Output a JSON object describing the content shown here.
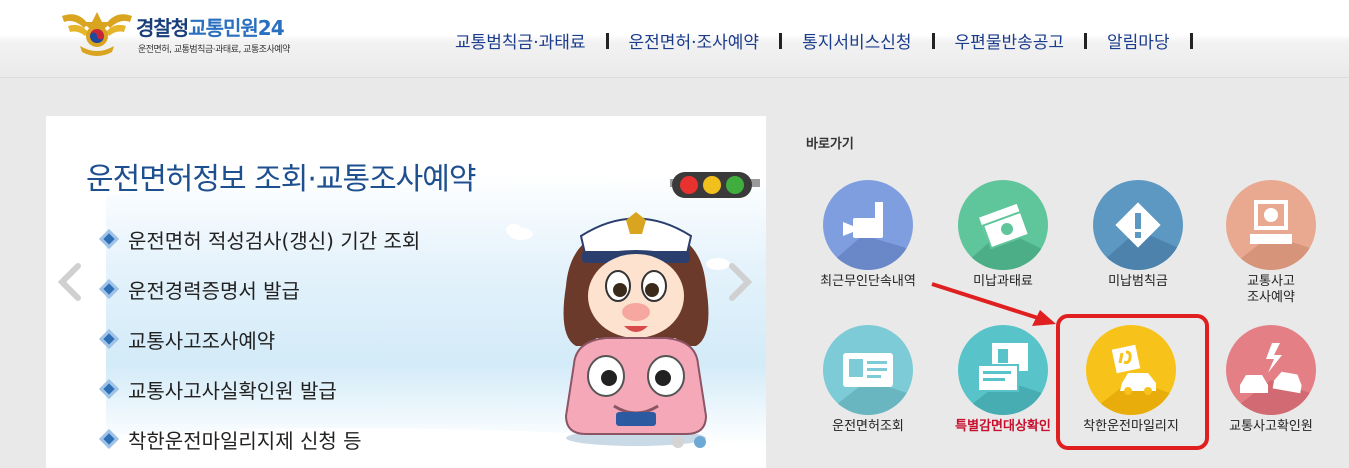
{
  "header": {
    "logo": {
      "title_part1": "경찰청",
      "title_part2": "교통민원24",
      "subtitle": "운전면허, 교통범칙금·과태료, 교통조사예약"
    },
    "nav": [
      {
        "label": "교통범칙금·과태료"
      },
      {
        "label": "운전면허·조사예약"
      },
      {
        "label": "통지서비스신청"
      },
      {
        "label": "우편물반송공고"
      },
      {
        "label": "알림마당"
      }
    ]
  },
  "slider": {
    "title": "운전면허정보 조회·교통조사예약",
    "items": [
      {
        "label": "운전면허 적성검사(갱신) 기간 조회"
      },
      {
        "label": "운전경력증명서 발급"
      },
      {
        "label": "교통사고조사예약"
      },
      {
        "label": "교통사고사실확인원 발급"
      },
      {
        "label": "착한운전마일리지제 신청 등"
      }
    ],
    "page_indicator": {
      "total": 2,
      "active": 2
    }
  },
  "quick_links": {
    "title": "바로가기",
    "items": [
      {
        "label": "최근무인단속내역",
        "icon": "camera-icon",
        "color": "#7f9ee0"
      },
      {
        "label": "미납과태료",
        "icon": "money-icon",
        "color": "#5fc59a"
      },
      {
        "label": "미납범칙금",
        "icon": "warning-icon",
        "color": "#5d98c2"
      },
      {
        "label_line1": "교통사고",
        "label_line2": "조사예약",
        "icon": "computer-icon",
        "color": "#e8a990"
      },
      {
        "label": "운전면허조회",
        "icon": "id-card-icon",
        "color": "#7dcbd6"
      },
      {
        "label": "특별감면대상확인",
        "icon": "document-card-icon",
        "color": "#58c4c9",
        "label_color": "#c8102e"
      },
      {
        "label": "착한운전마일리지",
        "icon": "mileage-car-icon",
        "color": "#f7c21a",
        "highlighted": true
      },
      {
        "label": "교통사고확인원",
        "icon": "car-crash-icon",
        "color": "#e57f86"
      }
    ]
  },
  "colors": {
    "highlight": "#e02020",
    "nav_text": "#1b3c8c",
    "slide_title": "#1e4f8f"
  }
}
